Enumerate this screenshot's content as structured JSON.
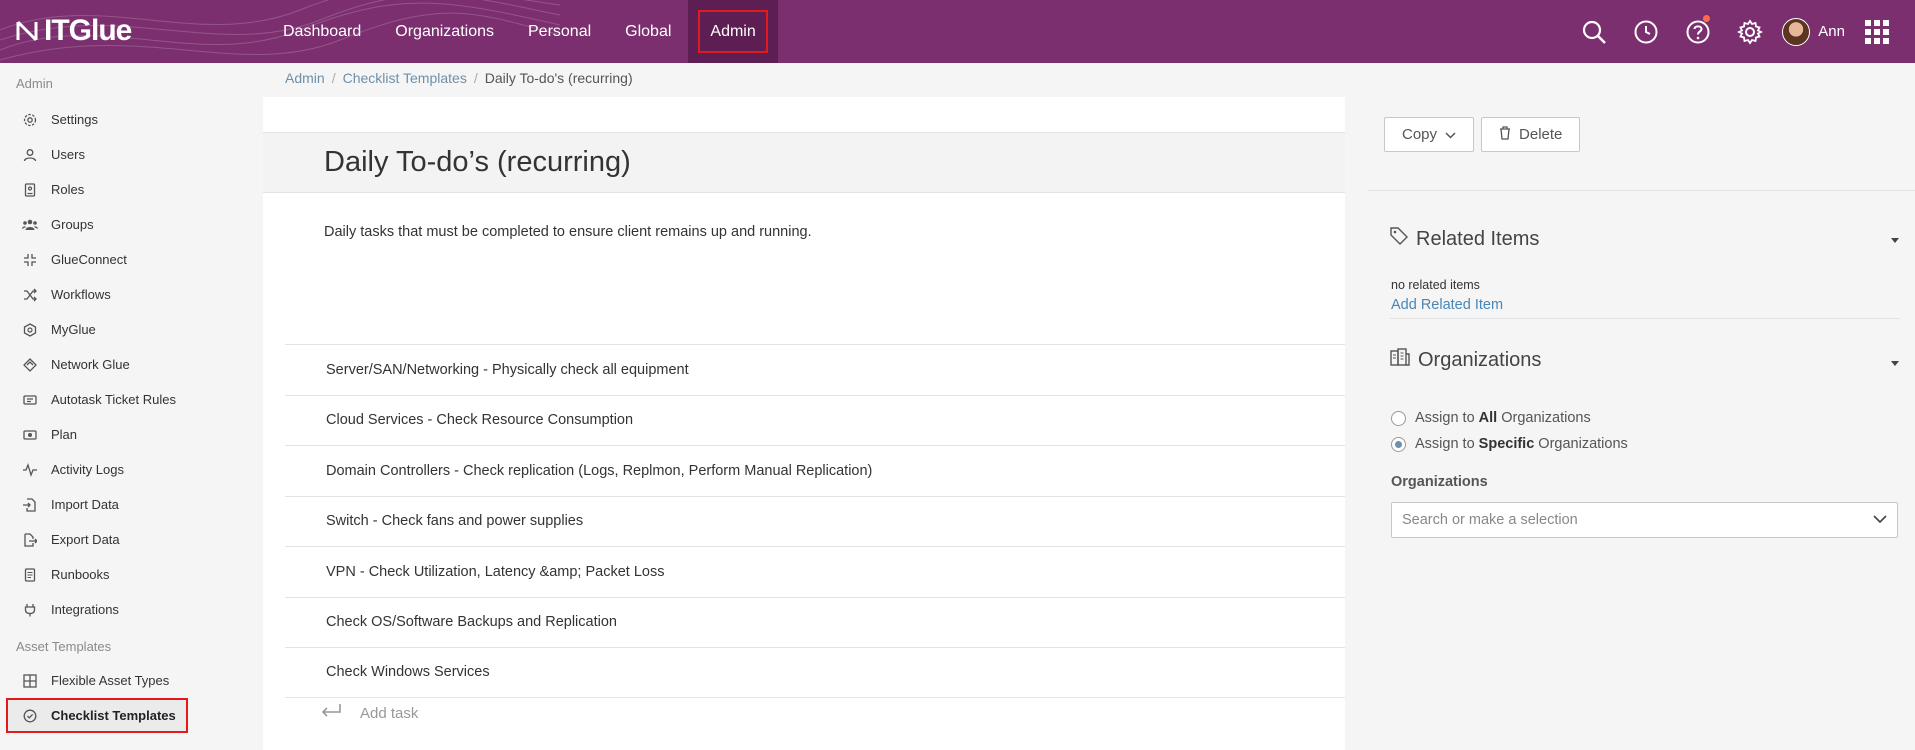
{
  "app": {
    "logo": "ITGlue"
  },
  "nav": {
    "items": [
      {
        "label": "Dashboard"
      },
      {
        "label": "Organizations"
      },
      {
        "label": "Personal"
      },
      {
        "label": "Global"
      },
      {
        "label": "Admin",
        "active": true
      }
    ]
  },
  "header_right": {
    "icons": [
      "search-icon",
      "clock-icon",
      "help-icon",
      "gear-icon"
    ],
    "user_name": "Ann",
    "apps_icon": "apps-grid-icon"
  },
  "sidebar": {
    "section_admin": "Admin",
    "admin_items": [
      {
        "label": "Settings",
        "icon": "settings-icon"
      },
      {
        "label": "Users",
        "icon": "user-icon"
      },
      {
        "label": "Roles",
        "icon": "roles-icon"
      },
      {
        "label": "Groups",
        "icon": "groups-icon"
      },
      {
        "label": "GlueConnect",
        "icon": "glueconnect-icon"
      },
      {
        "label": "Workflows",
        "icon": "workflows-icon"
      },
      {
        "label": "MyGlue",
        "icon": "myglue-icon"
      },
      {
        "label": "Network Glue",
        "icon": "network-glue-icon"
      },
      {
        "label": "Autotask Ticket Rules",
        "icon": "ticket-rules-icon"
      },
      {
        "label": "Plan",
        "icon": "plan-icon"
      },
      {
        "label": "Activity Logs",
        "icon": "activity-icon"
      },
      {
        "label": "Import Data",
        "icon": "import-icon"
      },
      {
        "label": "Export Data",
        "icon": "export-icon"
      },
      {
        "label": "Runbooks",
        "icon": "runbooks-icon"
      },
      {
        "label": "Integrations",
        "icon": "integrations-icon"
      }
    ],
    "section_assets": "Asset Templates",
    "asset_items": [
      {
        "label": "Flexible Asset Types",
        "icon": "grid-icon"
      },
      {
        "label": "Checklist Templates",
        "icon": "check-circle-icon",
        "active": true
      }
    ]
  },
  "breadcrumb": {
    "items": [
      "Admin",
      "Checklist Templates",
      "Daily To-do's (recurring)"
    ],
    "separator": "/"
  },
  "main": {
    "title": "Daily To-do’s (recurring)",
    "description": "Daily tasks that must be completed to ensure client remains up and running.",
    "tasks": [
      "Server/SAN/Networking - Physically check all equipment",
      "Cloud Services - Check Resource Consumption",
      "Domain Controllers - Check replication (Logs, Replmon, Perform Manual Replication)",
      "Switch - Check fans and power supplies",
      "VPN - Check Utilization, Latency &amp; Packet Loss",
      "Check OS/Software Backups and Replication",
      "Check Windows Services"
    ],
    "add_task_placeholder": "Add task"
  },
  "right_panel": {
    "copy_label": "Copy",
    "delete_label": "Delete",
    "related_title": "Related Items",
    "no_related": "no related items",
    "add_related": "Add Related Item",
    "orgs_title": "Organizations",
    "assign_all_prefix": "Assign to ",
    "assign_all_bold": "All",
    "assign_all_suffix": " Organizations",
    "assign_specific_prefix": "Assign to ",
    "assign_specific_bold": "Specific",
    "assign_specific_suffix": " Organizations",
    "assign_selected": "specific",
    "orgs_field_label": "Organizations",
    "orgs_placeholder": "Search or make a selection"
  },
  "colors": {
    "header_bg": "#7b2f6f",
    "active_nav_bg": "#5d1f53",
    "highlight_outline": "#e3191b",
    "link": "#4a86b5"
  }
}
